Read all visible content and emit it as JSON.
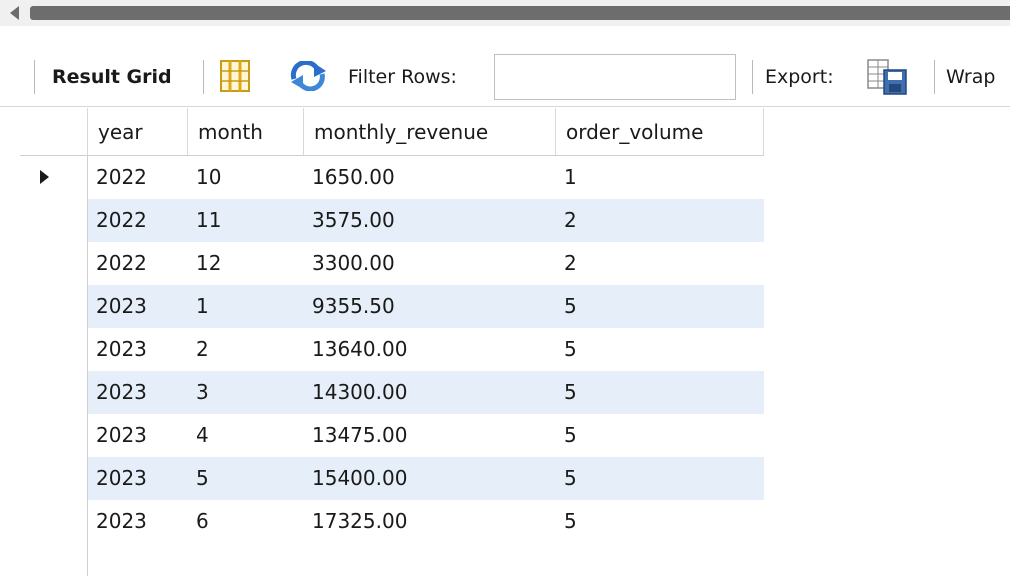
{
  "toolbar": {
    "result_grid_label": "Result Grid",
    "filter_rows_label": "Filter Rows:",
    "filter_value": "",
    "export_label": "Export:",
    "wrap_label": "Wrap"
  },
  "icons": {
    "grid_toggle": "grid-layout-icon",
    "refresh": "refresh-icon",
    "export": "export-save-icon",
    "row_marker": "current-row-arrow-icon"
  },
  "colors": {
    "alt_row": "#e6eff9",
    "accent_blue": "#2a6fc9"
  },
  "table": {
    "columns": [
      "year",
      "month",
      "monthly_revenue",
      "order_volume"
    ],
    "rows": [
      [
        "2022",
        "10",
        "1650.00",
        "1"
      ],
      [
        "2022",
        "11",
        "3575.00",
        "2"
      ],
      [
        "2022",
        "12",
        "3300.00",
        "2"
      ],
      [
        "2023",
        "1",
        "9355.50",
        "5"
      ],
      [
        "2023",
        "2",
        "13640.00",
        "5"
      ],
      [
        "2023",
        "3",
        "14300.00",
        "5"
      ],
      [
        "2023",
        "4",
        "13475.00",
        "5"
      ],
      [
        "2023",
        "5",
        "15400.00",
        "5"
      ],
      [
        "2023",
        "6",
        "17325.00",
        "5"
      ]
    ]
  }
}
